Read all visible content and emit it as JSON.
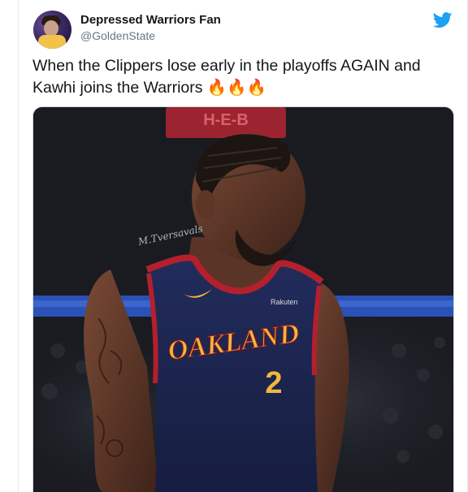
{
  "tweet": {
    "author_name": "Depressed Warriors Fan",
    "author_handle": "@GoldenState",
    "text": "When the Clippers lose early in the playoffs AGAIN and Kawhi joins the Warriors 🔥🔥🔥"
  },
  "media": {
    "jersey_text": "OAKLAND",
    "jersey_number": "2",
    "sponsor_text": "Rakuten",
    "signature_text": "M.Tversavals",
    "arena_sign_text": "H-E-B"
  },
  "colors": {
    "twitter_blue": "#1da1f2",
    "jersey_navy": "#1c2550",
    "jersey_gold": "#f2b63f",
    "jersey_red": "#b3202c"
  }
}
